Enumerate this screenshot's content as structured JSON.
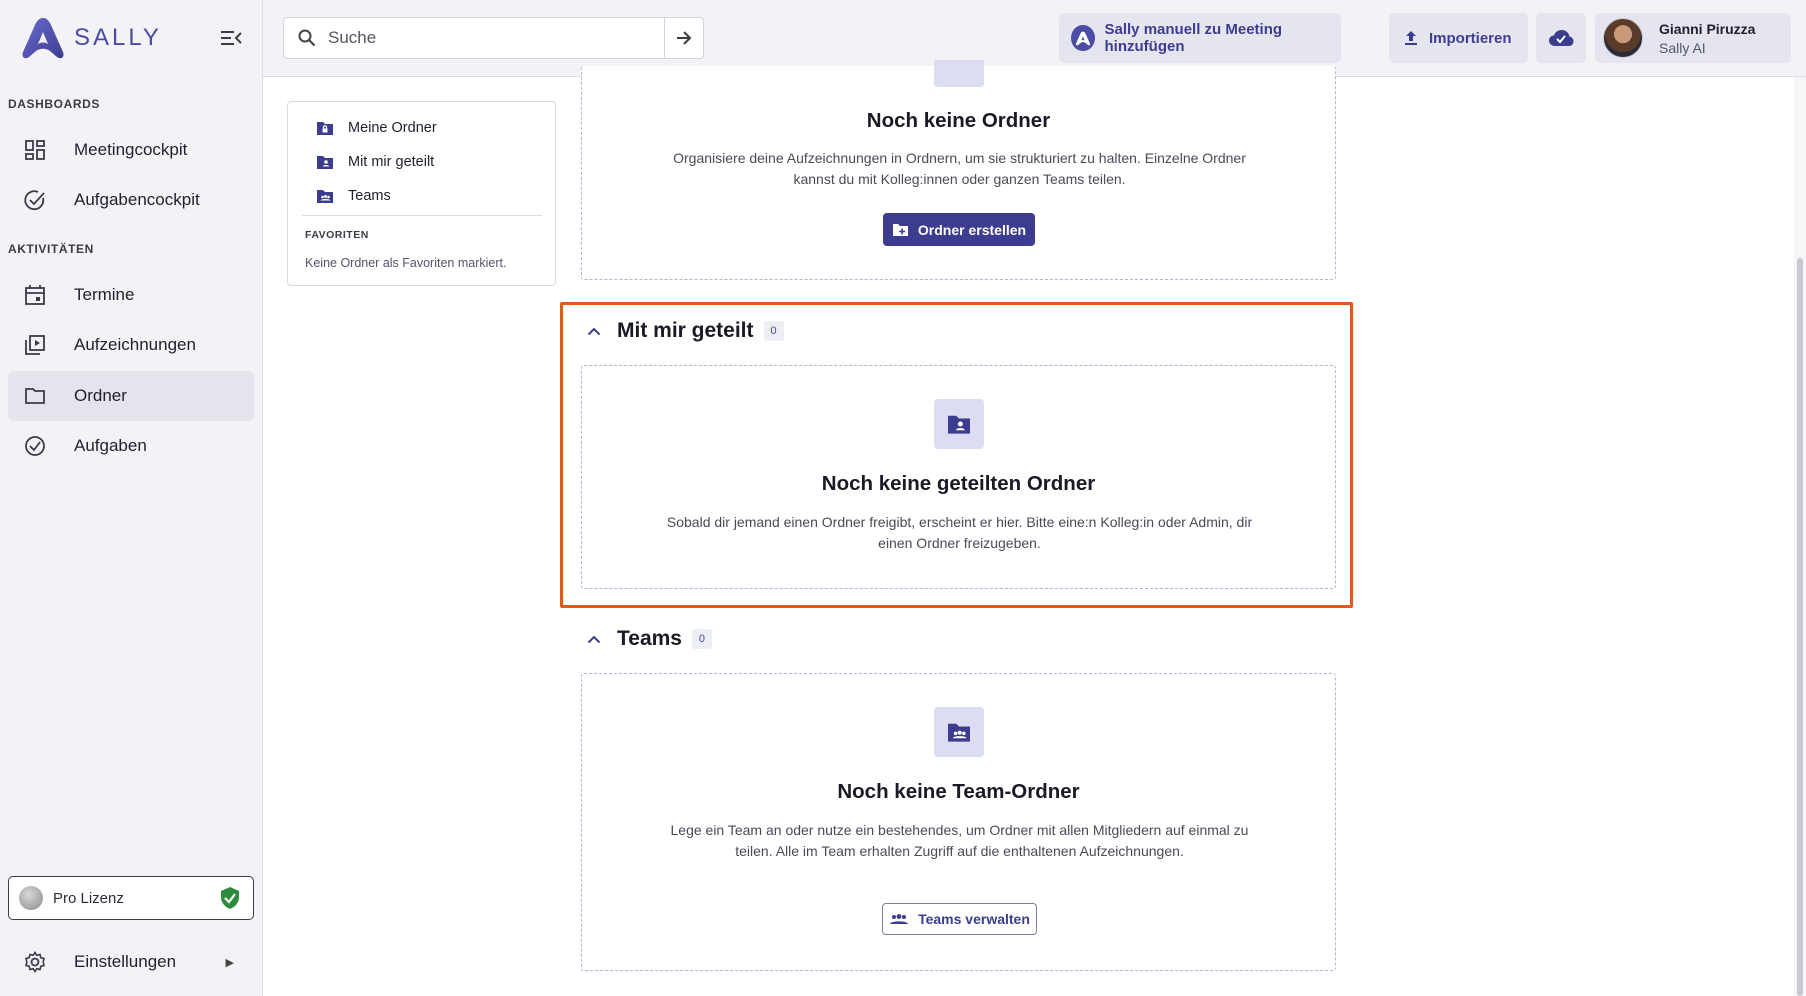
{
  "app": {
    "logo_text": "SALLY"
  },
  "sidebar": {
    "section_dashboards": "DASHBOARDS",
    "section_activities": "AKTIVITÄTEN",
    "items": [
      {
        "label": "Meetingcockpit",
        "icon": "dashboard-grid-icon"
      },
      {
        "label": "Aufgabencockpit",
        "icon": "check-circle-icon"
      },
      {
        "label": "Termine",
        "icon": "calendar-icon"
      },
      {
        "label": "Aufzeichnungen",
        "icon": "recordings-play-icon"
      },
      {
        "label": "Ordner",
        "icon": "folder-icon",
        "active": true
      },
      {
        "label": "Aufgaben",
        "icon": "check-circle-icon"
      }
    ],
    "license_label": "Pro Lizenz",
    "settings_label": "Einstellungen"
  },
  "header": {
    "search_placeholder": "Suche",
    "add_meeting_label": "Sally manuell zu Meeting hinzufügen",
    "import_label": "Importieren",
    "user_name": "Gianni Piruzza",
    "user_role": "Sally AI"
  },
  "folder_panel": {
    "items": [
      {
        "label": "Meine Ordner",
        "icon": "locked-folder-icon"
      },
      {
        "label": "Mit mir geteilt",
        "icon": "shared-folder-icon"
      },
      {
        "label": "Teams",
        "icon": "team-folder-icon"
      }
    ],
    "favorites_title": "FAVORITEN",
    "favorites_empty": "Keine Ordner als Favoriten markiert."
  },
  "sections": {
    "my_folders": {
      "empty_title": "Noch keine Ordner",
      "empty_desc": "Organisiere deine Aufzeichnungen in Ordnern, um sie strukturiert zu halten. Einzelne Ordner kannst du mit Kolleg:innen oder ganzen Teams teilen.",
      "button_label": "Ordner erstellen"
    },
    "shared": {
      "title": "Mit mir geteilt",
      "count": "0",
      "empty_title": "Noch keine geteilten Ordner",
      "empty_desc": "Sobald dir jemand einen Ordner freigibt, erscheint er hier. Bitte eine:n Kolleg:in oder Admin, dir einen Ordner freizugeben."
    },
    "teams": {
      "title": "Teams",
      "count": "0",
      "empty_title": "Noch keine Team-Ordner",
      "empty_desc": "Lege ein Team an oder nutze ein bestehendes, um Ordner mit allen Mitgliedern auf einmal zu teilen. Alle im Team erhalten Zugriff auf die enthaltenen Aufzeichnungen.",
      "button_label": "Teams verwalten"
    }
  },
  "colors": {
    "accent": "#3d3d8f",
    "highlight": "#e05a1a",
    "license_shield": "#2e8b3e"
  }
}
